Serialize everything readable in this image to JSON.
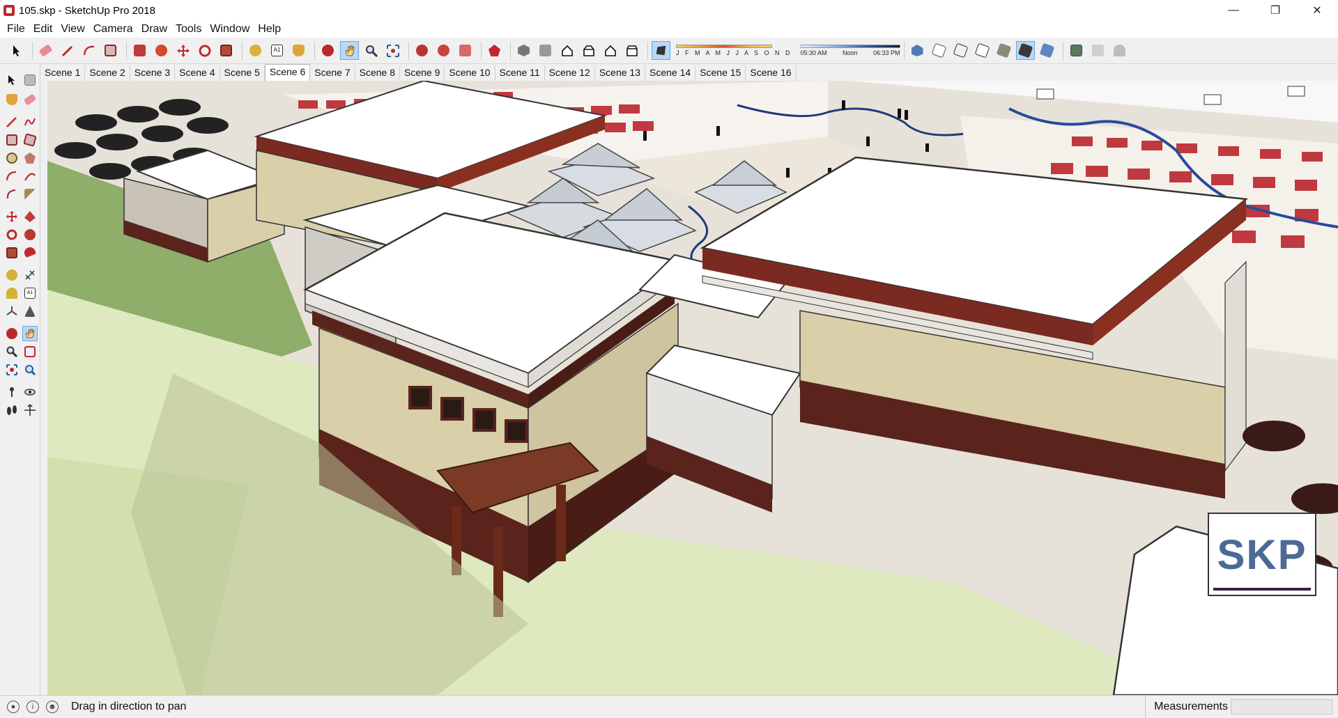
{
  "window": {
    "title": "105.skp - SketchUp Pro 2018",
    "controls": [
      "minimize-icon",
      "restore-icon",
      "close-icon"
    ]
  },
  "menu": [
    "File",
    "Edit",
    "View",
    "Camera",
    "Draw",
    "Tools",
    "Window",
    "Help"
  ],
  "shadow_settings": {
    "months_label": "J F M A M J J A S O N D",
    "time_start": "05:30 AM",
    "time_mid": "Noon",
    "time_end": "06:33 PM"
  },
  "scenes": {
    "tabs": [
      "Scene 1",
      "Scene 2",
      "Scene 3",
      "Scene 4",
      "Scene 5",
      "Scene 6",
      "Scene 7",
      "Scene 8",
      "Scene 9",
      "Scene 10",
      "Scene 11",
      "Scene 12",
      "Scene 13",
      "Scene 14",
      "Scene 15",
      "Scene 16"
    ],
    "active": "Scene 6"
  },
  "status": {
    "message": "Drag in direction to pan",
    "measurements_label": "Measurements",
    "measurements_value": ""
  },
  "watermark": {
    "text": "SKP"
  },
  "colors": {
    "accent_active": "#b9d8f5",
    "roof_red": "#c0393f",
    "wall_beige": "#d9cfa9",
    "trim_brown": "#5a231c",
    "ground_green": "#dfe9bf"
  }
}
